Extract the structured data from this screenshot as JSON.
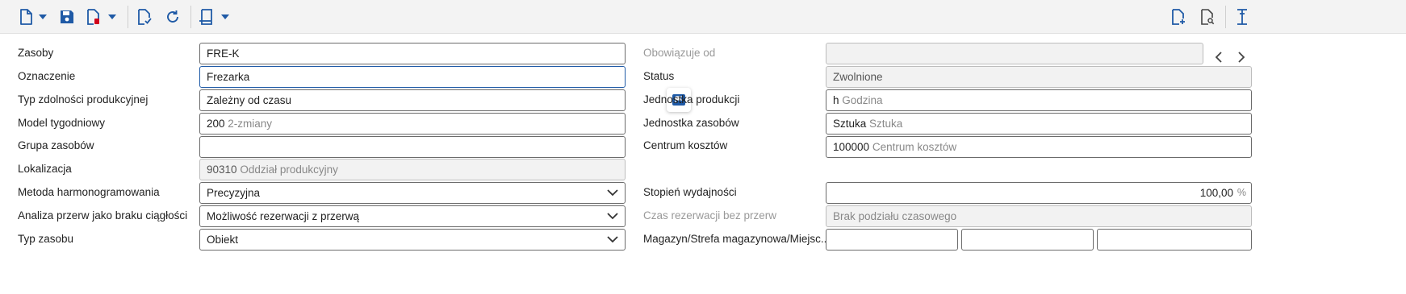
{
  "toolbar": {
    "icons": [
      "new-document-icon",
      "dropdown-icon",
      "save-icon",
      "delete-document-icon",
      "dropdown-icon",
      "validate-document-icon",
      "refresh-icon",
      "print-document-icon",
      "dropdown-icon",
      "add-document-icon",
      "preview-document-icon",
      "text-cursor-icon"
    ]
  },
  "colors": {
    "accent": "#1f5aa6",
    "delete_red": "#d0021b"
  },
  "left": {
    "resources_label": "Zasoby",
    "resources_value": "FRE-K",
    "designation_label": "Oznaczenie",
    "designation_value": "Frezarka",
    "capacity_type_label": "Typ zdolności produkcyjnej",
    "capacity_type_value": "Zależny od czasu",
    "week_model_label": "Model tygodniowy",
    "week_model_code": "200",
    "week_model_desc": "2-zmiany",
    "resource_group_label": "Grupa zasobów",
    "resource_group_value": "",
    "location_label": "Lokalizacja",
    "location_code": "90310",
    "location_desc": "Oddział produkcyjny",
    "scheduling_method_label": "Metoda harmonogramowania",
    "scheduling_method_value": "Precyzyjna",
    "break_analysis_label": "Analiza przerw jako braku ciągłości",
    "break_analysis_value": "Możliwość rezerwacji z przerwą",
    "resource_type_label": "Typ zasobu",
    "resource_type_value": "Obiekt"
  },
  "right": {
    "valid_from_label": "Obowiązuje od",
    "valid_from_value": "",
    "status_label": "Status",
    "status_value": "Zwolnione",
    "production_unit_label": "Jednostka produkcji",
    "production_unit_code": "h",
    "production_unit_desc": "Godzina",
    "resource_unit_label": "Jednostka zasobów",
    "resource_unit_code": "Sztuka",
    "resource_unit_desc": "Sztuka",
    "cost_center_label": "Centrum kosztów",
    "cost_center_code": "100000",
    "cost_center_desc": "Centrum kosztów",
    "efficiency_label": "Stopień wydajności",
    "efficiency_value": "100,00",
    "efficiency_unit": "%",
    "reservation_time_label": "Czas rezerwacji bez przerw",
    "reservation_time_value": "Brak podziału czasowego",
    "warehouse_label": "Magazyn/Strefa magazynowa/Miejsc..."
  }
}
